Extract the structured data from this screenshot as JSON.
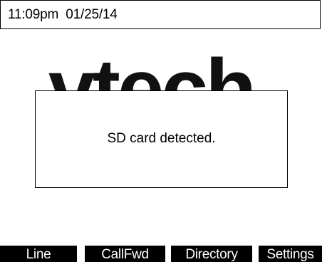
{
  "status_bar": {
    "time_date": "11:09pm  01/25/14"
  },
  "logo": {
    "text": "vtech"
  },
  "dialog": {
    "message": "SD card detected."
  },
  "softkeys": [
    {
      "label": "Line"
    },
    {
      "label": "CallFwd"
    },
    {
      "label": "Directory"
    },
    {
      "label": "Settings"
    }
  ]
}
